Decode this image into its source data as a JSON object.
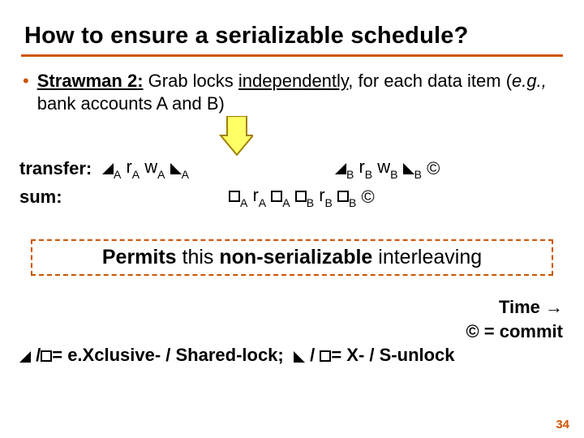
{
  "title": "How to ensure a serializable schedule?",
  "bullet": {
    "lead": "Strawman 2:",
    "rest1": " Grab locks ",
    "rest_u": "independently",
    "rest2": ", for each data item (",
    "eg": "e.g.,",
    "rest3": " bank accounts A and B)"
  },
  "rows": {
    "transfer_lbl": "transfer:",
    "sum_lbl": "sum:",
    "rA": "r",
    "wA": "w",
    "A": "A",
    "B": "B",
    "commit": "©"
  },
  "permits": {
    "t1": "Permits",
    "t2": " this ",
    "t3": "non-serializable",
    "t4": " interleaving"
  },
  "legend": {
    "time": "Time →",
    "commit": "© = commit",
    "l1a": " /",
    "l1b": "= e.Xclusive- / Shared-lock;",
    "l2a": " / ",
    "l2b": "= X- / S-unlock"
  },
  "pagenum": "34"
}
